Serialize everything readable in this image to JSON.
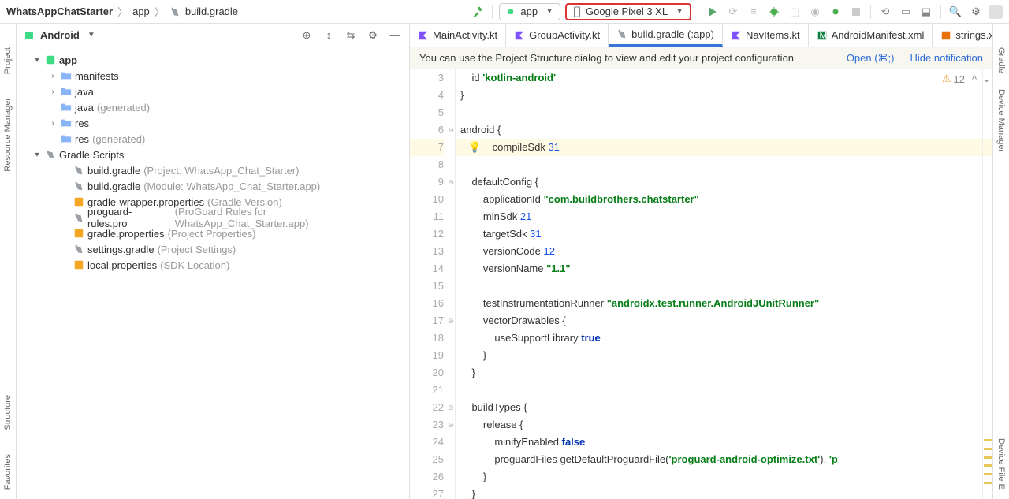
{
  "breadcrumb": {
    "project": "WhatsAppChatStarter",
    "module": "app",
    "file": "build.gradle"
  },
  "toolbar": {
    "config": "app",
    "device": "Google Pixel 3 XL"
  },
  "sidebar": {
    "mode": "Android",
    "root": "app",
    "items": [
      "manifests",
      "java",
      "java",
      "res",
      "res"
    ],
    "java_gen": "(generated)",
    "res_gen": "(generated)",
    "gradle": "Gradle Scripts",
    "scripts": [
      {
        "f": "build.gradle",
        "h": "(Project: WhatsApp_Chat_Starter)"
      },
      {
        "f": "build.gradle",
        "h": "(Module: WhatsApp_Chat_Starter.app)"
      },
      {
        "f": "gradle-wrapper.properties",
        "h": "(Gradle Version)"
      },
      {
        "f": "proguard-rules.pro",
        "h": "(ProGuard Rules for WhatsApp_Chat_Starter.app)"
      },
      {
        "f": "gradle.properties",
        "h": "(Project Properties)"
      },
      {
        "f": "settings.gradle",
        "h": "(Project Settings)"
      },
      {
        "f": "local.properties",
        "h": "(SDK Location)"
      }
    ]
  },
  "tabs": [
    {
      "label": "MainActivity.kt"
    },
    {
      "label": "GroupActivity.kt"
    },
    {
      "label": "build.gradle (:app)",
      "active": true
    },
    {
      "label": "NavItems.kt"
    },
    {
      "label": "AndroidManifest.xml"
    },
    {
      "label": "strings.x"
    }
  ],
  "notice": {
    "text": "You can use the Project Structure dialog to view and edit your project configuration",
    "open": "Open (⌘;)",
    "hide": "Hide notification"
  },
  "warn": "12",
  "code": {
    "start": 3,
    "lines": [
      {
        "t": "    id",
        "s": " 'kotlin-android'"
      },
      {
        "t": "}"
      },
      {
        "t": ""
      },
      {
        "t": "android {",
        "fold": true
      },
      {
        "t": "    compileSdk ",
        "n": "31",
        "hl": true,
        "bulb": true,
        "cur": true
      },
      {
        "t": ""
      },
      {
        "t": "    defaultConfig {",
        "fold": true
      },
      {
        "t": "        applicationId ",
        "s": "\"com.buildbrothers.chatstarter\""
      },
      {
        "t": "        minSdk ",
        "n": "21"
      },
      {
        "t": "        targetSdk ",
        "n": "31"
      },
      {
        "t": "        versionCode ",
        "n": "12"
      },
      {
        "t": "        versionName ",
        "s": "\"1.1\""
      },
      {
        "t": ""
      },
      {
        "t": "        testInstrumentationRunner ",
        "s": "\"androidx.test.runner.AndroidJUnitRunner\""
      },
      {
        "t": "        vectorDrawables {",
        "fold": true
      },
      {
        "t": "            useSupportLibrary ",
        "k": "true"
      },
      {
        "t": "        }"
      },
      {
        "t": "    }"
      },
      {
        "t": ""
      },
      {
        "t": "    buildTypes {",
        "fold": true
      },
      {
        "t": "        release {",
        "fold": true
      },
      {
        "t": "            minifyEnabled ",
        "k": "false"
      },
      {
        "pg": true
      },
      {
        "t": "        }"
      },
      {
        "t": "    }"
      }
    ]
  },
  "rails": {
    "left": [
      "Project",
      "Resource Manager",
      "Structure",
      "Favorites"
    ],
    "right": [
      "Gradle",
      "Device Manager",
      "Device File E"
    ]
  }
}
